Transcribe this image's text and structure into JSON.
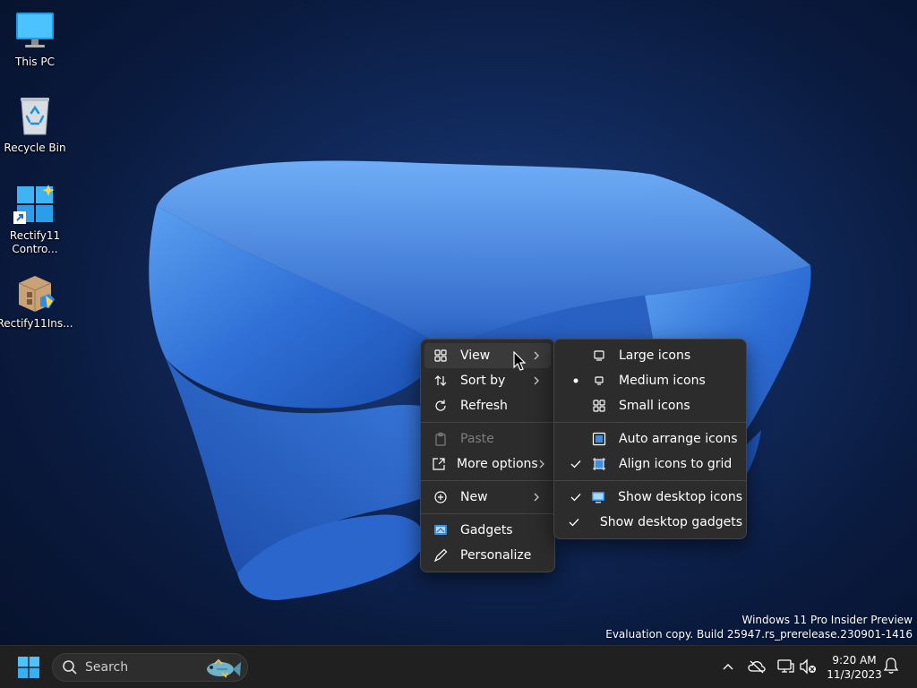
{
  "desktop": {
    "icons": [
      {
        "label": "This PC"
      },
      {
        "label": "Recycle Bin"
      },
      {
        "label": "Rectify11\nContro..."
      },
      {
        "label": "Rectify11Ins..."
      }
    ]
  },
  "context_menu": {
    "items": {
      "view": "View",
      "sort_by": "Sort by",
      "refresh": "Refresh",
      "paste": "Paste",
      "more_options": "More options",
      "new": "New",
      "gadgets": "Gadgets",
      "personalize": "Personalize"
    }
  },
  "view_submenu": {
    "large_icons": "Large icons",
    "medium_icons": "Medium icons",
    "small_icons": "Small icons",
    "auto_arrange": "Auto arrange icons",
    "align_to_grid": "Align icons to grid",
    "show_desktop_icons": "Show desktop icons",
    "show_desktop_gadgets": "Show desktop gadgets"
  },
  "watermark": {
    "line1": "Windows 11 Pro Insider Preview",
    "line2": "Evaluation copy. Build 25947.rs_prerelease.230901-1416"
  },
  "taskbar": {
    "search_placeholder": "Search",
    "time": "9:20 AM",
    "date": "11/3/2023"
  },
  "colors": {
    "accent": "#4cc2ff",
    "menu_bg": "#2c2c2c",
    "taskbar_bg": "#202020",
    "ribbon": "#3a7bd5"
  }
}
